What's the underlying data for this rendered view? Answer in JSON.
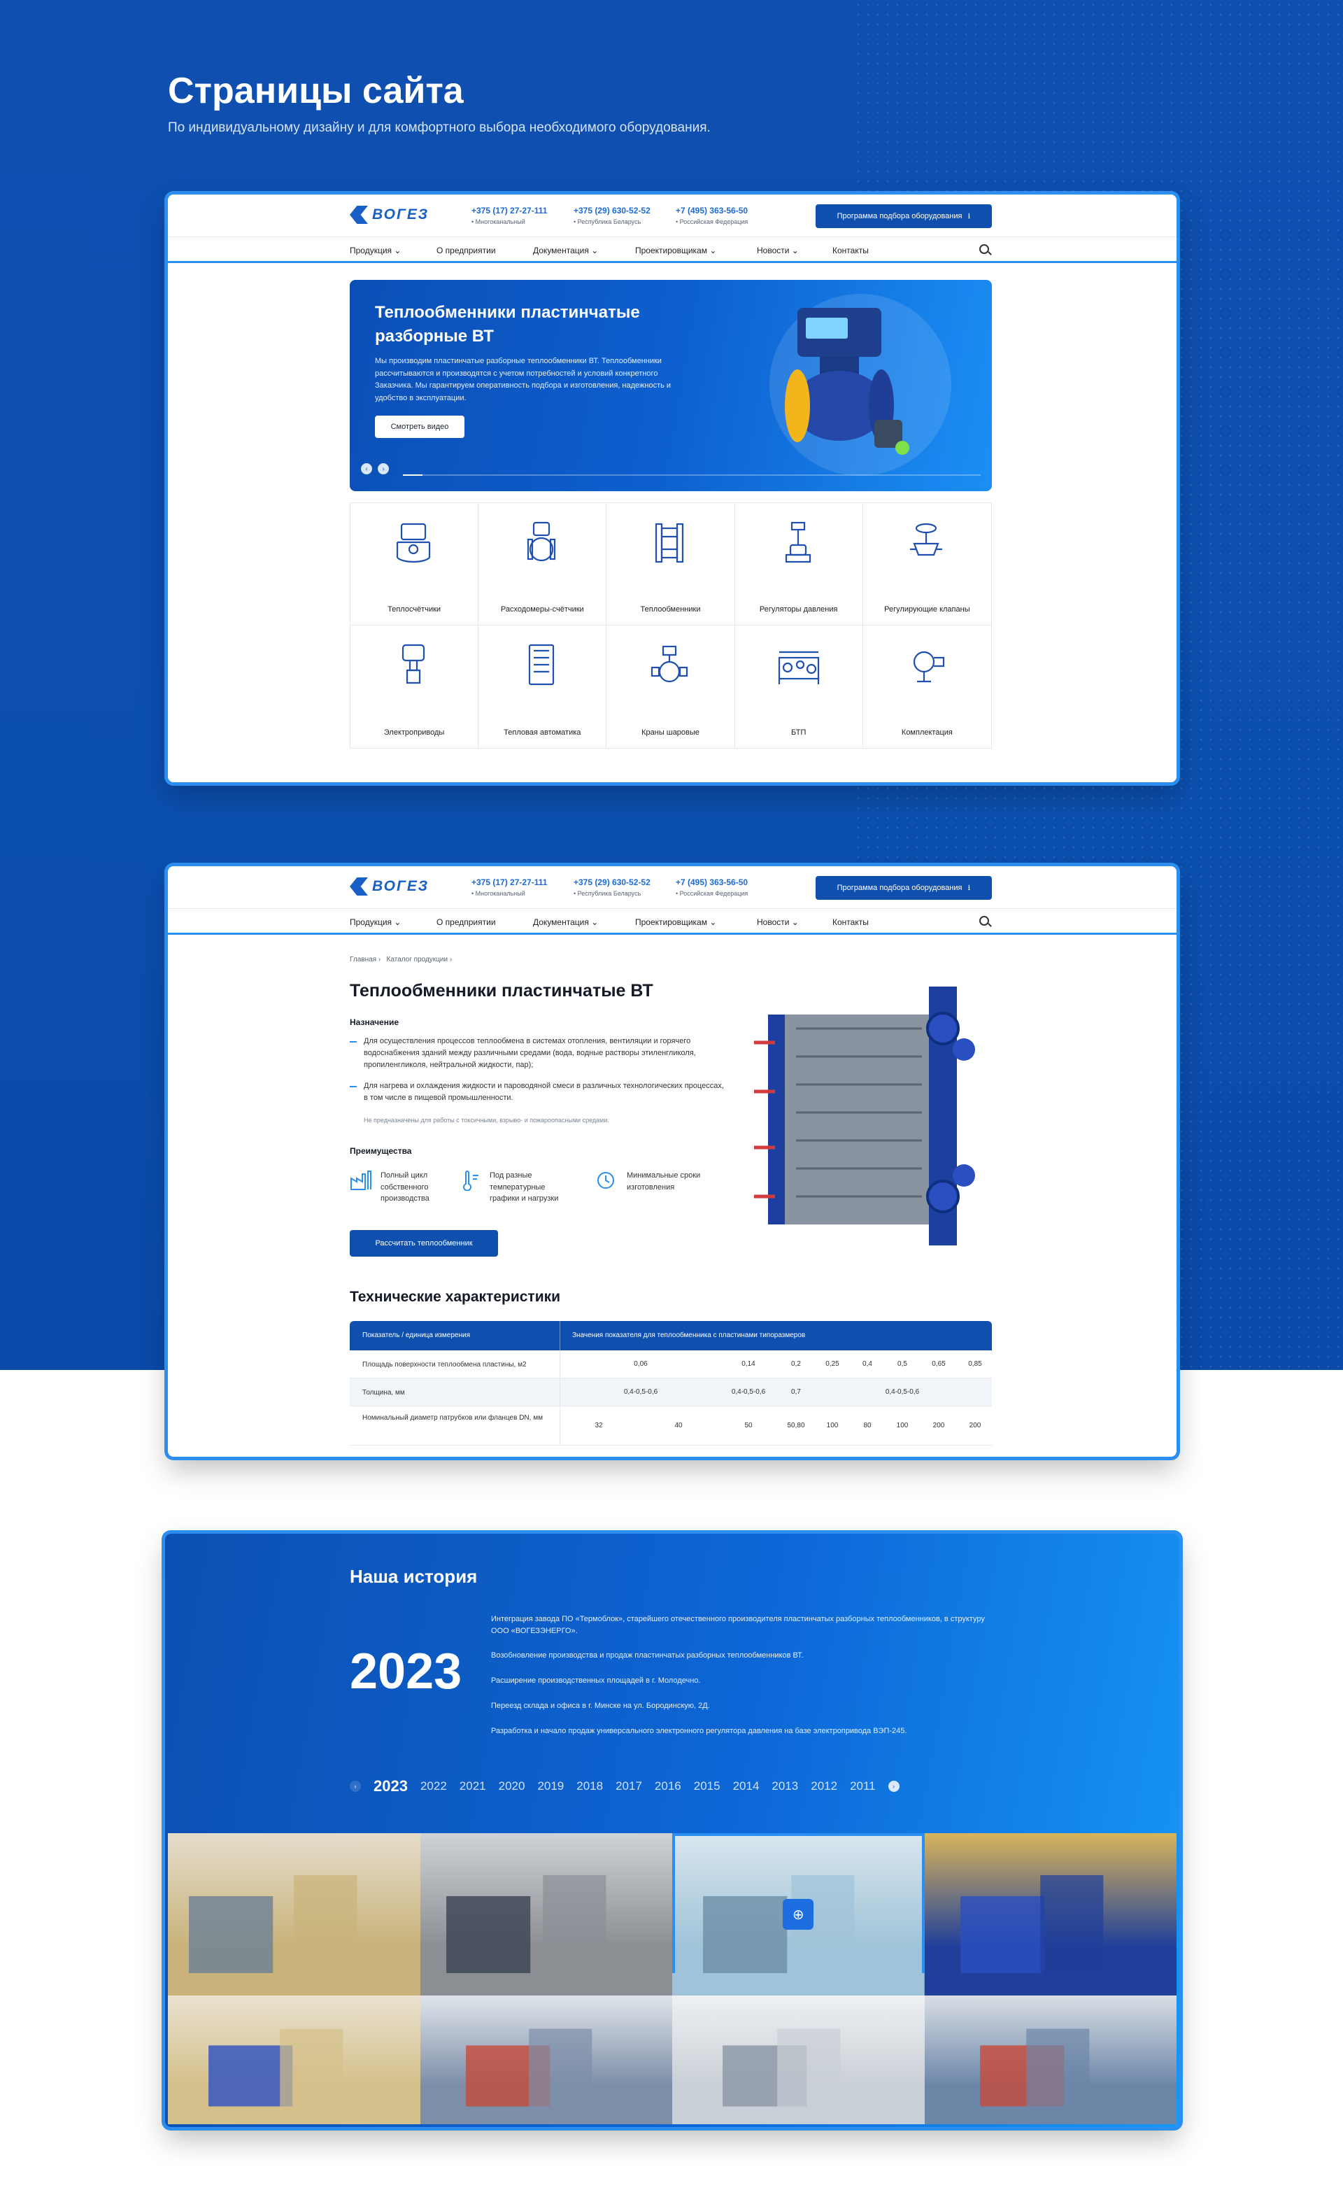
{
  "page": {
    "title": "Страницы сайта",
    "subtitle": "По индивидуальному дизайну и для комфортного выбора необходимого оборудования."
  },
  "site": {
    "logo_text": "ВОГЕЗ",
    "phones": [
      {
        "number": "+375 (17) 27-27-111",
        "location": "• Многоканальный"
      },
      {
        "number": "+375 (29) 630-52-52",
        "location": "• Республика Беларусь"
      },
      {
        "number": "+7 (495) 363-56-50",
        "location": "• Российская Федерация"
      }
    ],
    "program_button": "Программа подбора оборудования",
    "nav": [
      "Продукция",
      "О предприятии",
      "Документация",
      "Проектировщикам",
      "Новости",
      "Контакты"
    ],
    "colors": {
      "primary": "#0f4fae",
      "accent": "#2a8ff0"
    }
  },
  "home": {
    "hero": {
      "title": "Теплообменники пластинчатые разборные ВТ",
      "text": "Мы производим пластинчатые разборные теплообменники ВТ. Теплообменники рассчитываются и производятся с учетом потребностей и условий конкретного Заказчика. Мы гарантируем оперативность подбора и изготовления, надежность и удобство в эксплуатации.",
      "button": "Смотреть видео"
    },
    "categories": [
      {
        "label": "Теплосчётчики",
        "icon": "heat-meter-icon"
      },
      {
        "label": "Расходомеры-счётчики",
        "icon": "flow-meter-icon"
      },
      {
        "label": "Теплообменники",
        "icon": "heat-exchanger-icon"
      },
      {
        "label": "Регуляторы давления",
        "icon": "pressure-regulator-icon"
      },
      {
        "label": "Регулирующие клапаны",
        "icon": "control-valve-icon"
      },
      {
        "label": "Электроприводы",
        "icon": "actuator-icon"
      },
      {
        "label": "Тепловая автоматика",
        "icon": "automation-cabinet-icon"
      },
      {
        "label": "Краны шаровые",
        "icon": "ball-valve-icon"
      },
      {
        "label": "БТП",
        "icon": "heat-point-icon"
      },
      {
        "label": "Комплектация",
        "icon": "pump-icon"
      }
    ]
  },
  "product": {
    "breadcrumbs": [
      "Главная",
      "Каталог продукции"
    ],
    "title": "Теплообменники пластинчатые ВТ",
    "purpose_heading": "Назначение",
    "purpose": [
      "Для осуществления процессов теплообмена в системах отопления, вентиляции и горячего водоснабжения зданий между различными средами (вода, водные растворы этиленгликоля, пропиленгликоля, нейтральной жидкости, пар);",
      "Для нагрева и охлаждения жидкости и пароводяной смеси в различных технологических процессах, в том числе в пищевой промышленности."
    ],
    "note": "Не предназначены для работы с токсичными, взрыво- и пожароопасными средами.",
    "advantages_heading": "Преимущества",
    "advantages": [
      {
        "text": "Полный цикл собственного производства",
        "icon": "factory-icon"
      },
      {
        "text": "Под разные температурные графики и нагрузки",
        "icon": "thermometer-icon"
      },
      {
        "text": "Минимальные сроки изготовления",
        "icon": "clock-gear-icon"
      }
    ],
    "calc_button": "Рассчитать теплообменник",
    "tech_title": "Технические характеристики",
    "table": {
      "head_left": "Показатель / единица измерения",
      "head_right": "Значения показателя для теплообменника с пластинами типоразмеров",
      "rows": [
        {
          "label": "Площадь поверхности теплообмена пластины, м2",
          "values": [
            "0,06",
            "0,14",
            "0,2",
            "0,25",
            "0,4",
            "0,5",
            "0,65",
            "0,85"
          ]
        },
        {
          "label": "Толщина, мм",
          "values": [
            "0,4-0,5-0,6",
            "0,4-0,5-0,6",
            "0,7",
            "0,4-0,5-0,6"
          ]
        },
        {
          "label": "Номинальный диаметр патрубков или фланцев DN, мм",
          "values": [
            "32",
            "40",
            "50",
            "50,80",
            "100",
            "80",
            "100",
            "200",
            "200"
          ]
        }
      ]
    }
  },
  "history": {
    "title": "Наша история",
    "year": "2023",
    "events": [
      "Интеграция завода ПО «Термоблок», старейшего отечественного производителя пластинчатых разборных теплообменников, в структуру ООО «ВОГЕЗЭНЕРГО».",
      "Возобновление производства и продаж пластинчатых разборных теплообменников ВТ.",
      "Расширение производственных площадей в г. Молодечно.",
      "Переезд склада и офиса в г. Минске на ул. Бородинскую, 2Д.",
      "Разработка и начало продаж универсального электронного регулятора давления на базе электропривода ВЭП-245."
    ],
    "timeline": [
      "2023",
      "2022",
      "2021",
      "2020",
      "2019",
      "2018",
      "2017",
      "2016",
      "2015",
      "2014",
      "2013",
      "2012",
      "2011"
    ]
  }
}
